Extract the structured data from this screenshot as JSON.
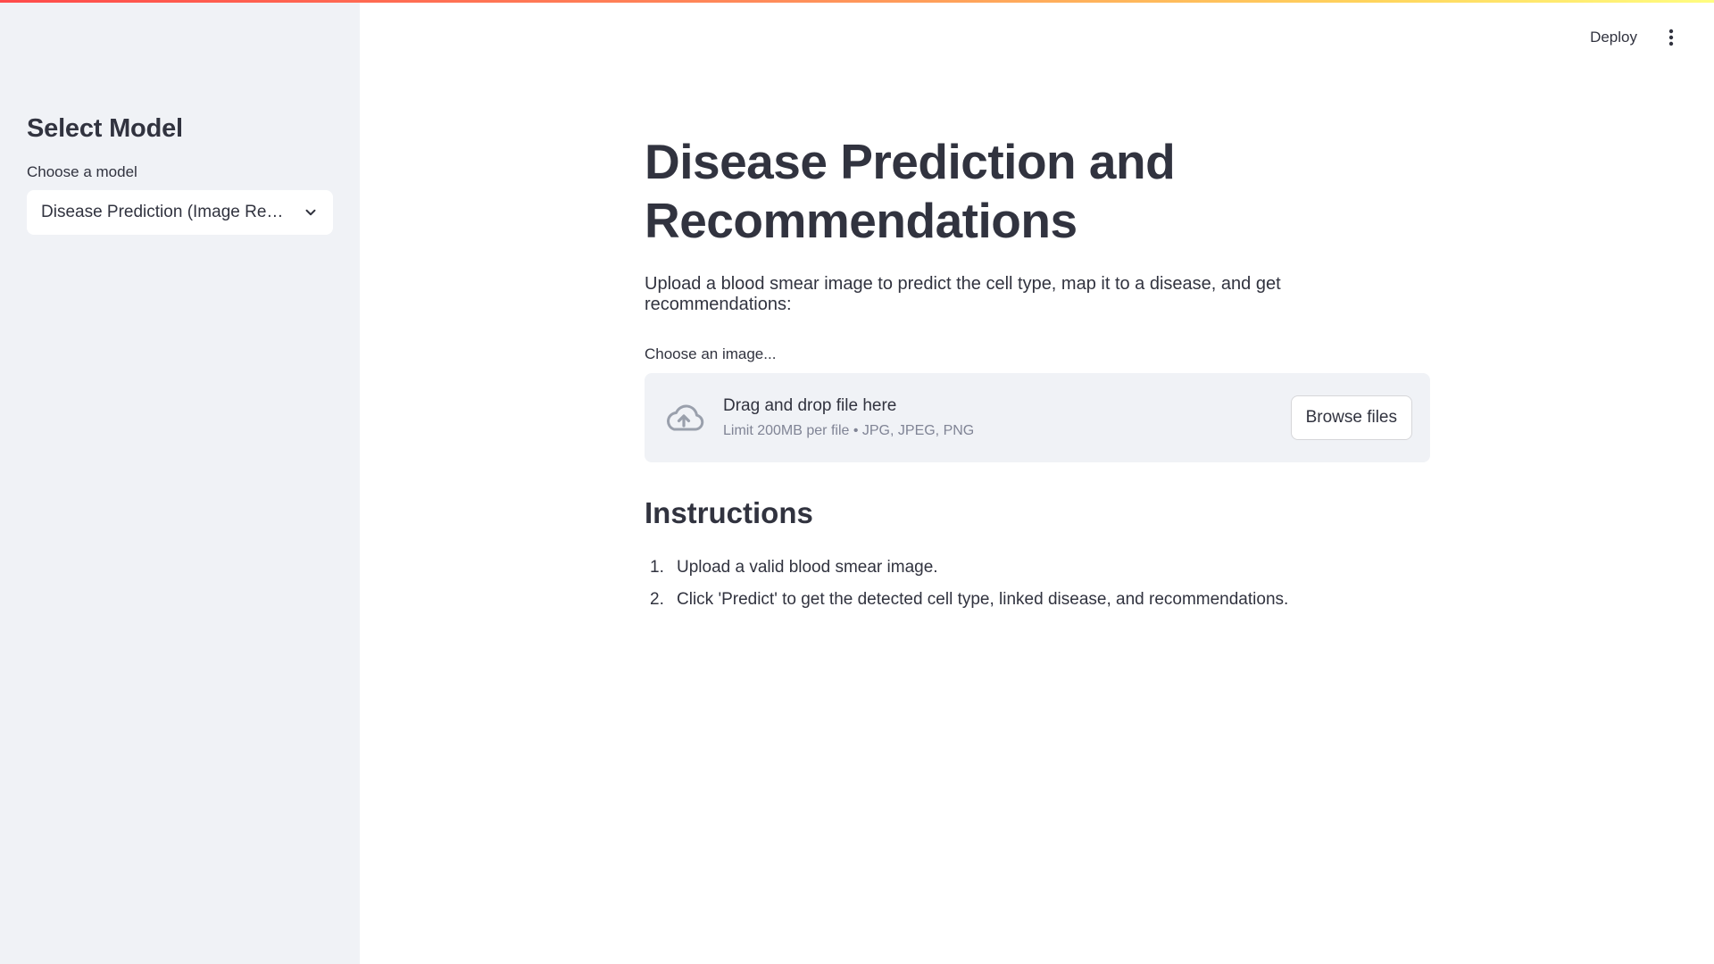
{
  "sidebar": {
    "title": "Select Model",
    "select_label": "Choose a model",
    "select_value": "Disease Prediction (Image Recognition)"
  },
  "header": {
    "deploy_label": "Deploy",
    "menu_icon": "kebab-menu-icon"
  },
  "main": {
    "title_line1": "Disease Prediction and",
    "title_line2": "Recommendations",
    "subtitle": "Upload a blood smear image to predict the cell type, map it to a disease, and get recommendations:",
    "uploader": {
      "label": "Choose an image...",
      "drop_title": "Drag and drop file here",
      "limit": "Limit 200MB per file • JPG, JPEG, PNG",
      "browse_label": "Browse files",
      "icon": "cloud-upload-icon"
    },
    "instructions": {
      "heading": "Instructions",
      "items": [
        {
          "num": "1.",
          "text": "Upload a valid blood smear image."
        },
        {
          "num": "2.",
          "text": "Click 'Predict' to get the detected cell type, linked disease, and recommendations."
        }
      ]
    }
  },
  "colors": {
    "sidebar_bg": "#f0f2f6",
    "text": "#31333f",
    "muted": "#808495",
    "accent_gradient_start": "#ff4b4b",
    "accent_gradient_end": "#fffd80"
  }
}
